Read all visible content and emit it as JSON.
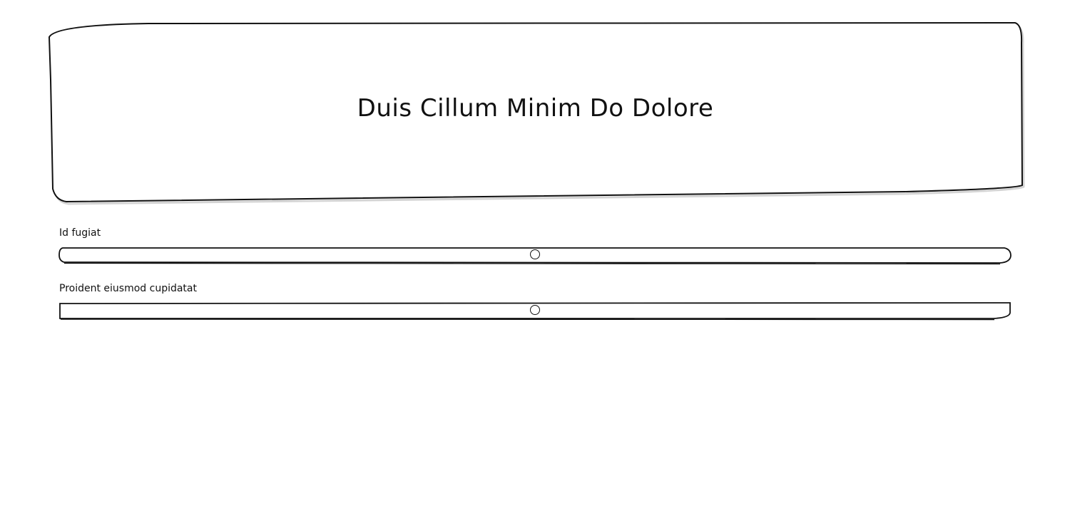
{
  "header": {
    "title": "Duis Cillum Minim Do Dolore"
  },
  "sliders": [
    {
      "label": "Id fugiat",
      "value": 0.5
    },
    {
      "label": "Proident eiusmod cupidatat",
      "value": 0.5
    }
  ],
  "colors": {
    "background": "#ffffff",
    "stroke": "#111111",
    "shadow": "#d4d4d4"
  }
}
